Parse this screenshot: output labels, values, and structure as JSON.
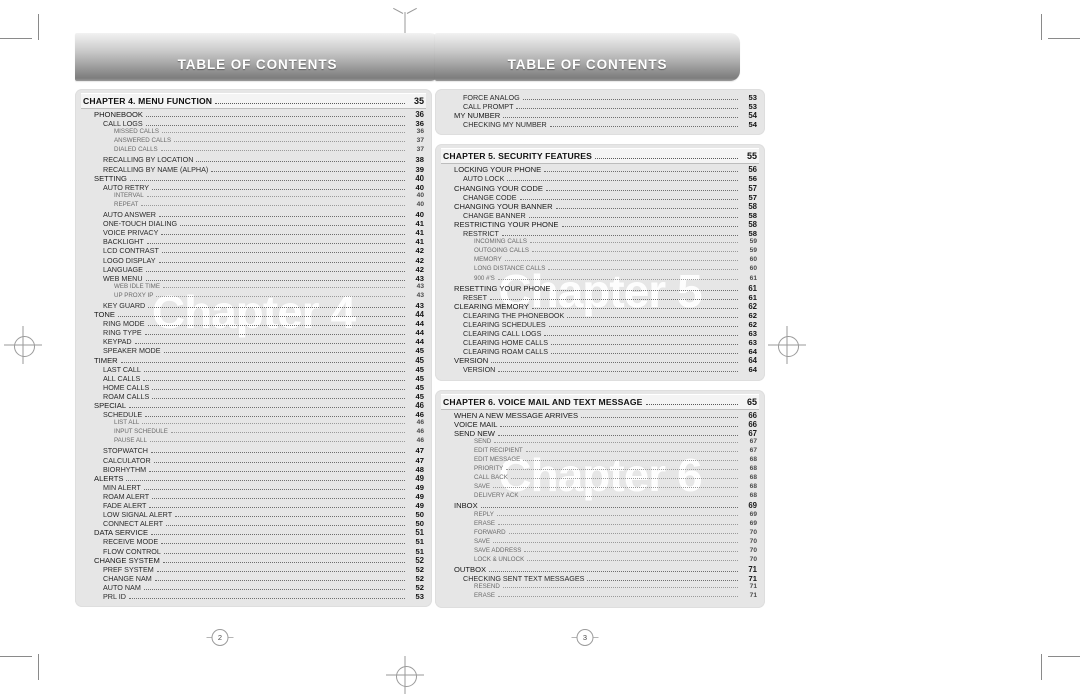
{
  "document": {
    "banner_title": "TABLE OF CONTENTS"
  },
  "pages": [
    {
      "page_number": "2",
      "watermark": "Chapter 4",
      "panels": [
        {
          "chapter": {
            "title": "CHAPTER 4. MENU FUNCTION",
            "page": "35"
          },
          "entries": [
            {
              "level": 1,
              "title": "PHONEBOOK",
              "page": "36"
            },
            {
              "level": 2,
              "title": "CALL LOGS",
              "page": "36"
            },
            {
              "level": 3,
              "title": "MISSED CALLS",
              "page": "36"
            },
            {
              "level": 3,
              "title": "ANSWERED CALLS",
              "page": "37"
            },
            {
              "level": 3,
              "title": "DIALED CALLS",
              "page": "37"
            },
            {
              "level": 2,
              "title": "RECALLING BY LOCATION",
              "page": "38"
            },
            {
              "level": 2,
              "title": "RECALLING BY NAME (ALPHA)",
              "page": "39"
            },
            {
              "level": 1,
              "title": "SETTING",
              "page": "40"
            },
            {
              "level": 2,
              "title": "AUTO RETRY",
              "page": "40"
            },
            {
              "level": 3,
              "title": "INTERVAL",
              "page": "40"
            },
            {
              "level": 3,
              "title": "REPEAT",
              "page": "40"
            },
            {
              "level": 2,
              "title": "AUTO ANSWER",
              "page": "40"
            },
            {
              "level": 2,
              "title": "ONE-TOUCH DIALING",
              "page": "41"
            },
            {
              "level": 2,
              "title": "VOICE PRIVACY",
              "page": "41"
            },
            {
              "level": 2,
              "title": "BACKLIGHT",
              "page": "41"
            },
            {
              "level": 2,
              "title": "LCD CONTRAST",
              "page": "42"
            },
            {
              "level": 2,
              "title": "LOGO DISPLAY",
              "page": "42"
            },
            {
              "level": 2,
              "title": "LANGUAGE",
              "page": "42"
            },
            {
              "level": 2,
              "title": "WEB MENU",
              "page": "43"
            },
            {
              "level": 3,
              "title": "WEB IDLE TIME",
              "page": "43"
            },
            {
              "level": 3,
              "title": "UP PROXY IP",
              "page": "43"
            },
            {
              "level": 2,
              "title": "KEY GUARD",
              "page": "43"
            },
            {
              "level": 1,
              "title": "TONE",
              "page": "44"
            },
            {
              "level": 2,
              "title": "RING MODE",
              "page": "44"
            },
            {
              "level": 2,
              "title": "RING TYPE",
              "page": "44"
            },
            {
              "level": 2,
              "title": "KEYPAD",
              "page": "44"
            },
            {
              "level": 2,
              "title": "SPEAKER MODE",
              "page": "45"
            },
            {
              "level": 1,
              "title": "TIMER",
              "page": "45"
            },
            {
              "level": 2,
              "title": "LAST CALL",
              "page": "45"
            },
            {
              "level": 2,
              "title": "ALL CALLS",
              "page": "45"
            },
            {
              "level": 2,
              "title": "HOME CALLS",
              "page": "45"
            },
            {
              "level": 2,
              "title": "ROAM CALLS",
              "page": "45"
            },
            {
              "level": 1,
              "title": "SPECIAL",
              "page": "46"
            },
            {
              "level": 2,
              "title": "SCHEDULE",
              "page": "46"
            },
            {
              "level": 3,
              "title": "LIST ALL",
              "page": "46"
            },
            {
              "level": 3,
              "title": "INPUT SCHEDULE",
              "page": "46"
            },
            {
              "level": 3,
              "title": "PAUSE ALL",
              "page": "46"
            },
            {
              "level": 2,
              "title": "STOPWATCH",
              "page": "47"
            },
            {
              "level": 2,
              "title": "CALCULATOR",
              "page": "47"
            },
            {
              "level": 2,
              "title": "BIORHYTHM",
              "page": "48"
            },
            {
              "level": 1,
              "title": "ALERTS",
              "page": "49"
            },
            {
              "level": 2,
              "title": "MIN ALERT",
              "page": "49"
            },
            {
              "level": 2,
              "title": "ROAM ALERT",
              "page": "49"
            },
            {
              "level": 2,
              "title": "FADE ALERT",
              "page": "49"
            },
            {
              "level": 2,
              "title": "LOW SIGNAL ALERT",
              "page": "50"
            },
            {
              "level": 2,
              "title": "CONNECT ALERT",
              "page": "50"
            },
            {
              "level": 1,
              "title": "DATA SERVICE",
              "page": "51"
            },
            {
              "level": 2,
              "title": "RECEIVE MODE",
              "page": "51"
            },
            {
              "level": 2,
              "title": "FLOW CONTROL",
              "page": "51"
            },
            {
              "level": 1,
              "title": "CHANGE SYSTEM",
              "page": "52"
            },
            {
              "level": 2,
              "title": "PREF SYSTEM",
              "page": "52"
            },
            {
              "level": 2,
              "title": "CHANGE NAM",
              "page": "52"
            },
            {
              "level": 2,
              "title": "AUTO NAM",
              "page": "52"
            },
            {
              "level": 2,
              "title": "PRL ID",
              "page": "53"
            }
          ]
        }
      ]
    },
    {
      "page_number": "3",
      "watermark_5": "Chapter 5",
      "watermark_6": "Chapter 6",
      "panels": [
        {
          "chapter": null,
          "entries": [
            {
              "level": 2,
              "title": "FORCE ANALOG",
              "page": "53"
            },
            {
              "level": 2,
              "title": "CALL PROMPT",
              "page": "53"
            },
            {
              "level": 1,
              "title": "MY NUMBER",
              "page": "54"
            },
            {
              "level": 2,
              "title": "CHECKING MY NUMBER",
              "page": "54"
            }
          ]
        },
        {
          "chapter": {
            "title": "CHAPTER 5. SECURITY FEATURES",
            "page": "55"
          },
          "entries": [
            {
              "level": 1,
              "title": "LOCKING YOUR PHONE",
              "page": "56"
            },
            {
              "level": 2,
              "title": "AUTO LOCK",
              "page": "56"
            },
            {
              "level": 1,
              "title": "CHANGING YOUR CODE",
              "page": "57"
            },
            {
              "level": 2,
              "title": "CHANGE CODE",
              "page": "57"
            },
            {
              "level": 1,
              "title": "CHANGING YOUR BANNER",
              "page": "58"
            },
            {
              "level": 2,
              "title": "CHANGE BANNER",
              "page": "58"
            },
            {
              "level": 1,
              "title": "RESTRICTING YOUR PHONE",
              "page": "58"
            },
            {
              "level": 2,
              "title": "RESTRICT",
              "page": "58"
            },
            {
              "level": 3,
              "title": "INCOMING CALLS",
              "page": "59"
            },
            {
              "level": 3,
              "title": "OUTGOING CALLS",
              "page": "59"
            },
            {
              "level": 3,
              "title": "MEMORY",
              "page": "60"
            },
            {
              "level": 3,
              "title": "LONG DISTANCE CALLS",
              "page": "60"
            },
            {
              "level": 3,
              "title": "900 #'S",
              "page": "61"
            },
            {
              "level": 1,
              "title": "RESETTING YOUR PHONE",
              "page": "61"
            },
            {
              "level": 2,
              "title": "RESET",
              "page": "61"
            },
            {
              "level": 1,
              "title": "CLEARING MEMORY",
              "page": "62"
            },
            {
              "level": 2,
              "title": "CLEARING THE PHONEBOOK",
              "page": "62"
            },
            {
              "level": 2,
              "title": "CLEARING SCHEDULES",
              "page": "62"
            },
            {
              "level": 2,
              "title": "CLEARING CALL LOGS",
              "page": "63"
            },
            {
              "level": 2,
              "title": "CLEARING HOME CALLS",
              "page": "63"
            },
            {
              "level": 2,
              "title": "CLEARING ROAM CALLS",
              "page": "64"
            },
            {
              "level": 1,
              "title": "VERSION",
              "page": "64"
            },
            {
              "level": 2,
              "title": "VERSION",
              "page": "64"
            }
          ]
        },
        {
          "chapter": {
            "title": "CHAPTER 6. VOICE MAIL AND TEXT MESSAGE",
            "page": "65"
          },
          "entries": [
            {
              "level": 1,
              "title": "WHEN A NEW MESSAGE ARRIVES",
              "page": "66"
            },
            {
              "level": 1,
              "title": "VOICE MAIL",
              "page": "66"
            },
            {
              "level": 1,
              "title": "SEND NEW",
              "page": "67"
            },
            {
              "level": 3,
              "title": "SEND",
              "page": "67"
            },
            {
              "level": 3,
              "title": "EDIT RECIPIENT",
              "page": "67"
            },
            {
              "level": 3,
              "title": "EDIT MESSAGE",
              "page": "68"
            },
            {
              "level": 3,
              "title": "PRIORITY",
              "page": "68"
            },
            {
              "level": 3,
              "title": "CALL BACK",
              "page": "68"
            },
            {
              "level": 3,
              "title": "SAVE",
              "page": "68"
            },
            {
              "level": 3,
              "title": "DELIVERY ACK",
              "page": "68"
            },
            {
              "level": 1,
              "title": "INBOX",
              "page": "69"
            },
            {
              "level": 3,
              "title": "REPLY",
              "page": "69"
            },
            {
              "level": 3,
              "title": "ERASE",
              "page": "69"
            },
            {
              "level": 3,
              "title": "FORWARD",
              "page": "70"
            },
            {
              "level": 3,
              "title": "SAVE",
              "page": "70"
            },
            {
              "level": 3,
              "title": "SAVE ADDRESS",
              "page": "70"
            },
            {
              "level": 3,
              "title": "LOCK & UNLOCK",
              "page": "70"
            },
            {
              "level": 1,
              "title": "OUTBOX",
              "page": "71"
            },
            {
              "level": 2,
              "title": "CHECKING SENT TEXT MESSAGES",
              "page": "71"
            },
            {
              "level": 3,
              "title": "RESEND",
              "page": "71"
            },
            {
              "level": 3,
              "title": "ERASE",
              "page": "71"
            }
          ]
        }
      ]
    }
  ]
}
